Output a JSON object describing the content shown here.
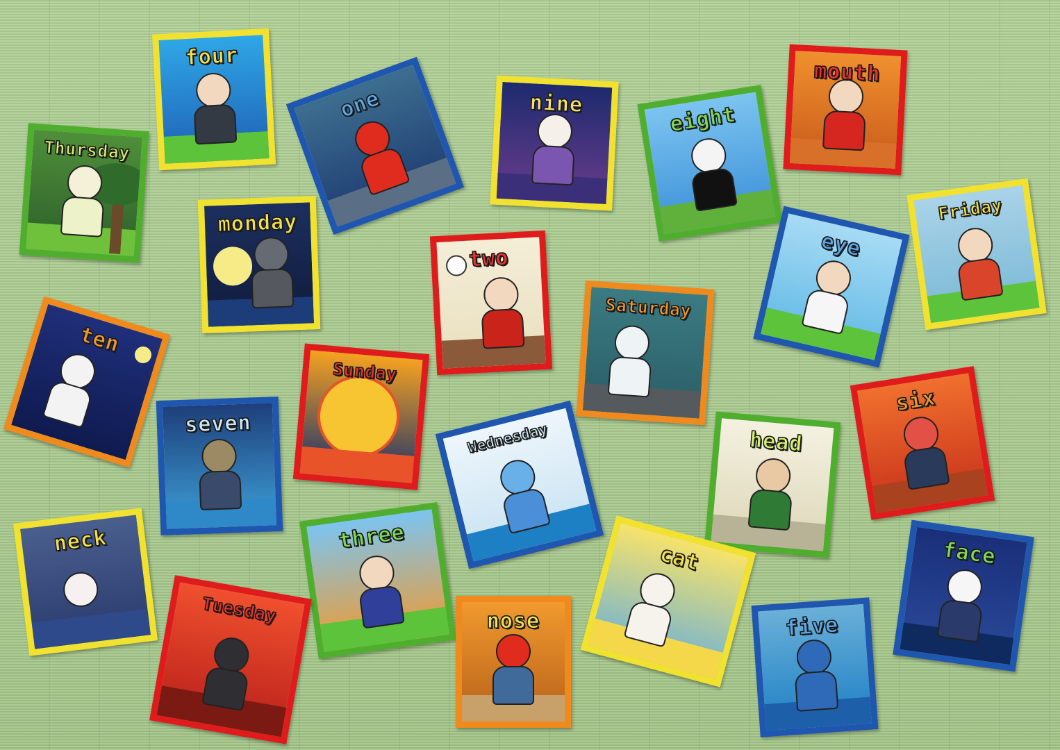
{
  "cards": [
    {
      "id": "four",
      "label": "four",
      "label_color": "#f4e04d",
      "border": "#f2e230",
      "sky": [
        "#2fa7e6",
        "#1e5fb4"
      ],
      "ground": "#5cc33b",
      "head": "#f3d8c0",
      "body": "#333a44"
    },
    {
      "id": "one",
      "label": "one",
      "label_color": "#5fa8e8",
      "border": "#1f56b0",
      "sky": [
        "#3d6e8f",
        "#1d3b72"
      ],
      "ground": "#5a6f86",
      "head": "#e02b1f",
      "body": "#e02b1f"
    },
    {
      "id": "nine",
      "label": "nine",
      "label_color": "#f6e26a",
      "border": "#f2e230",
      "sky": [
        "#1e2a6e",
        "#6a3d8c"
      ],
      "ground": "#3c2f7a",
      "head": "#f5f1ea",
      "body": "#7b56b0"
    },
    {
      "id": "eight",
      "label": "eight",
      "label_color": "#7ed957",
      "border": "#4fae2e",
      "sky": [
        "#7cc4f0",
        "#3a8fd8"
      ],
      "ground": "#5fb13c",
      "head": "#f4f4f4",
      "body": "#111111"
    },
    {
      "id": "mouth",
      "label": "mouth",
      "label_color": "#e8322b",
      "border": "#e01b1b",
      "sky": [
        "#f0902e",
        "#c85a1a"
      ],
      "ground": "#d9702a",
      "head": "#f3d8c0",
      "body": "#d5271f"
    },
    {
      "id": "thursday",
      "label": "Thursday",
      "label_color": "#d8f06a",
      "border": "#4fae2e",
      "sky": [
        "#4f8f3a",
        "#2d5f2a"
      ],
      "ground": "#6fc13b",
      "head": "#f4f1d8",
      "body": "#eef2c8"
    },
    {
      "id": "monday",
      "label": "monday",
      "label_color": "#f4e04d",
      "border": "#f2e230",
      "sky": [
        "#1c2f5e",
        "#0f1b3d"
      ],
      "ground": "#1c3d7a",
      "head": "#666a73",
      "body": "#55585f"
    },
    {
      "id": "two",
      "label": "two",
      "label_color": "#e8322b",
      "border": "#e01b1b",
      "sky": [
        "#f4eed8",
        "#e9dfbd"
      ],
      "ground": "#8a5a3a",
      "head": "#f3d8c0",
      "body": "#c9231a"
    },
    {
      "id": "saturday",
      "label": "Saturday",
      "label_color": "#f09a2e",
      "border": "#f08a1c",
      "sky": [
        "#3b7b82",
        "#2a5d66"
      ],
      "ground": "#555a5f",
      "head": "#eef3f6",
      "body": "#eef3f6"
    },
    {
      "id": "eye",
      "label": "eye",
      "label_color": "#5fa8e8",
      "border": "#1f56b0",
      "sky": [
        "#a7dbf4",
        "#5fb8e6"
      ],
      "ground": "#5cc33b",
      "head": "#f3d8c0",
      "body": "#f6f6f6"
    },
    {
      "id": "friday",
      "label": "Friday",
      "label_color": "#f4e04d",
      "border": "#f2e230",
      "sky": [
        "#a9d3e8",
        "#79b8d6"
      ],
      "ground": "#5cc33b",
      "head": "#f3d8c0",
      "body": "#d9452a"
    },
    {
      "id": "ten",
      "label": "ten",
      "label_color": "#f09a2e",
      "border": "#f08a1c",
      "sky": [
        "#1f2f7a",
        "#0f1a4f"
      ],
      "ground": "#ffffff",
      "head": "#f3f3f3",
      "body": "#f3f3f3"
    },
    {
      "id": "sunday",
      "label": "Sunday",
      "label_color": "#e8322b",
      "border": "#e01b1b",
      "sky": [
        "#f5a21f",
        "#1a2f6e"
      ],
      "ground": "#e8532a",
      "head": "#f7c532",
      "body": "#f7c532"
    },
    {
      "id": "seven",
      "label": "seven",
      "label_color": "#cfe8f4",
      "border": "#1f56b0",
      "sky": [
        "#1e3f7a",
        "#3ea0d8"
      ],
      "ground": "#2f88c8",
      "head": "#9b8a63",
      "body": "#3a4a6a"
    },
    {
      "id": "wednesday",
      "label": "Wednesday",
      "label_color": "#cfe8f4",
      "border": "#1f56b0",
      "sky": [
        "#eef6fb",
        "#c6e2f2"
      ],
      "ground": "#1d7fc4",
      "head": "#6ab0e8",
      "body": "#4a8fd8"
    },
    {
      "id": "head",
      "label": "head",
      "label_color": "#d8f06a",
      "border": "#4fae2e",
      "sky": [
        "#f4f1e0",
        "#dcd7b8"
      ],
      "ground": "#b8b296",
      "head": "#e8c9a4",
      "body": "#2f7a34"
    },
    {
      "id": "six",
      "label": "six",
      "label_color": "#f09a2e",
      "border": "#e01b1b",
      "sky": [
        "#f0702e",
        "#c8311a"
      ],
      "ground": "#a8421f",
      "head": "#e35045",
      "body": "#2a3a5a"
    },
    {
      "id": "neck",
      "label": "neck",
      "label_color": "#f4e04d",
      "border": "#f2e230",
      "sky": [
        "#4a5f8e",
        "#2a3a6e"
      ],
      "ground": "#2f4a8a",
      "head": "#f6f0f0",
      "body": "#2a2a2a"
    },
    {
      "id": "three",
      "label": "three",
      "label_color": "#7ed957",
      "border": "#4fae2e",
      "sky": [
        "#7cc4f0",
        "#f09a2e"
      ],
      "ground": "#5cc33b",
      "head": "#f3d8c0",
      "body": "#2f3f9a"
    },
    {
      "id": "tuesday",
      "label": "Tuesday",
      "label_color": "#e8322b",
      "border": "#e01b1b",
      "sky": [
        "#f0502e",
        "#b8201a"
      ],
      "ground": "#7a1a12",
      "head": "#2f2f33",
      "body": "#2f2f33"
    },
    {
      "id": "nose",
      "label": "nose",
      "label_color": "#f4e04d",
      "border": "#f08a1c",
      "sky": [
        "#f09a2e",
        "#b8601a"
      ],
      "ground": "#c8a06a",
      "head": "#e02b1f",
      "body": "#3f6a9a"
    },
    {
      "id": "cat",
      "label": "cat",
      "label_color": "#f4e04d",
      "border": "#f2e230",
      "sky": [
        "#f7e36a",
        "#6ab0d8"
      ],
      "ground": "#f5d84a",
      "head": "#f6f3ec",
      "body": "#f6f3ec"
    },
    {
      "id": "five",
      "label": "five",
      "label_color": "#5fa8e8",
      "border": "#1f56b0",
      "sky": [
        "#6ab0d8",
        "#1d7fc4"
      ],
      "ground": "#1d5fa8",
      "head": "#2f6ab8",
      "body": "#2f6ab8"
    },
    {
      "id": "face",
      "label": "face",
      "label_color": "#7ed957",
      "border": "#1f56b0",
      "sky": [
        "#1a2f7a",
        "#2a4a9a"
      ],
      "ground": "#0f2a5e",
      "head": "#f6f6f6",
      "body": "#2a3a6a"
    }
  ]
}
